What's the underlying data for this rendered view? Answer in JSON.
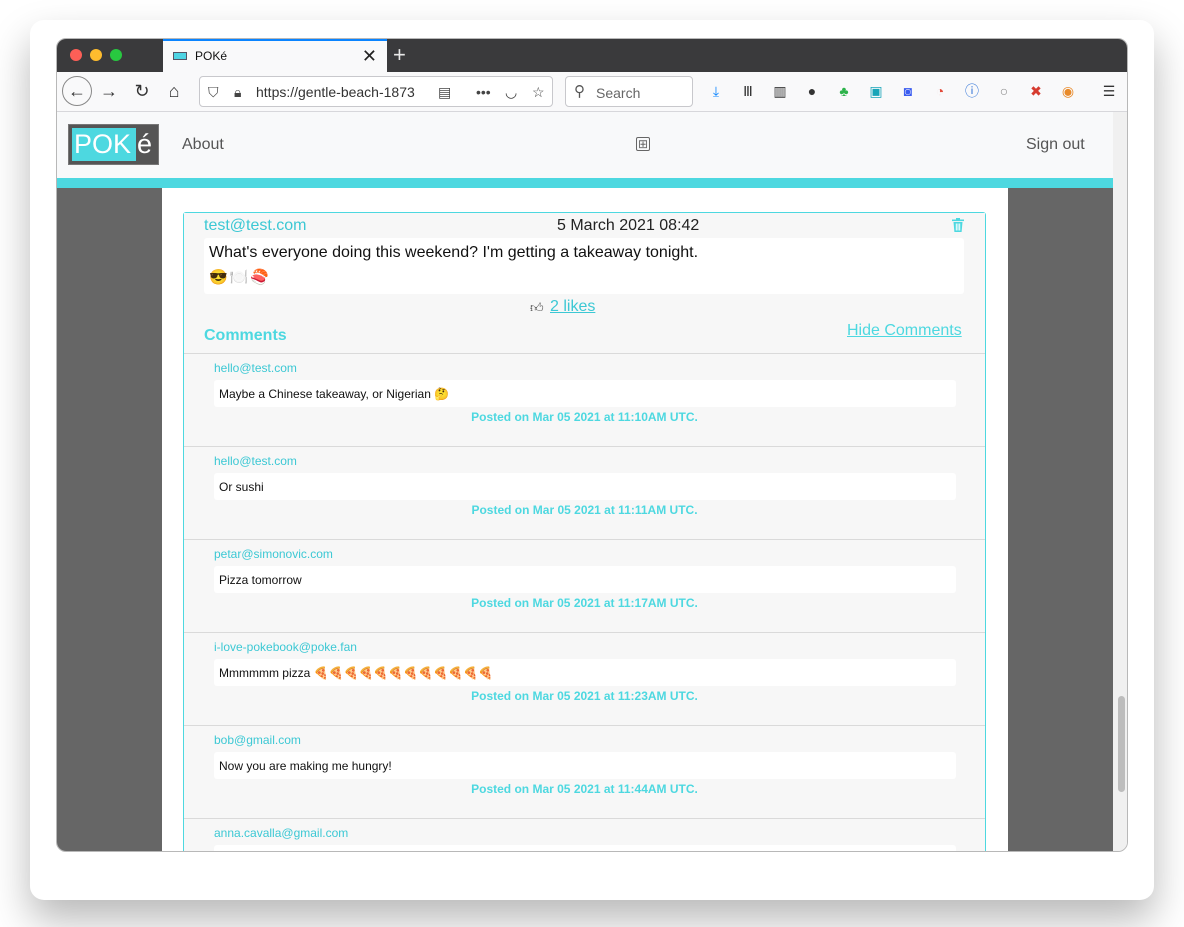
{
  "browser": {
    "tab_title": "POKé",
    "new_tab": "+",
    "tab_close": "✕",
    "url": "https://gentle-beach-1873",
    "search_placeholder": "Search"
  },
  "navbar": {
    "logo_main": "POK",
    "logo_accent": "é",
    "about": "About",
    "add_icon": "⊞",
    "sign_out": "Sign out"
  },
  "post": {
    "author": "test@test.com",
    "date": "5 March 2021 08:42",
    "text": "What's everyone doing this weekend? I'm getting a takeaway tonight.",
    "emoji": "😎🍽️🍣",
    "likes": " 2 likes",
    "comments_title": "Comments",
    "hide_comments": "Hide Comments"
  },
  "comments": [
    {
      "author": "hello@test.com",
      "text": "Maybe a Chinese takeaway, or Nigerian 🤔",
      "time": "Posted on Mar 05 2021 at 11:10AM UTC."
    },
    {
      "author": "hello@test.com",
      "text": "Or sushi",
      "time": "Posted on Mar 05 2021 at 11:11AM UTC."
    },
    {
      "author": "petar@simonovic.com",
      "text": "Pizza tomorrow",
      "time": "Posted on Mar 05 2021 at 11:17AM UTC."
    },
    {
      "author": "i-love-pokebook@poke.fan",
      "text": "Mmmmmm pizza 🍕🍕🍕🍕🍕🍕🍕🍕🍕🍕🍕🍕",
      "time": "Posted on Mar 05 2021 at 11:23AM UTC."
    },
    {
      "author": "bob@gmail.com",
      "text": "Now you are making me hungry!",
      "time": "Posted on Mar 05 2021 at 11:44AM UTC."
    },
    {
      "author": "anna.cavalla@gmail.com",
      "text": "",
      "time": ""
    }
  ],
  "colors": {
    "accent": "#4dd8e0",
    "link": "#3cc8d4",
    "page_bg": "#666666"
  }
}
